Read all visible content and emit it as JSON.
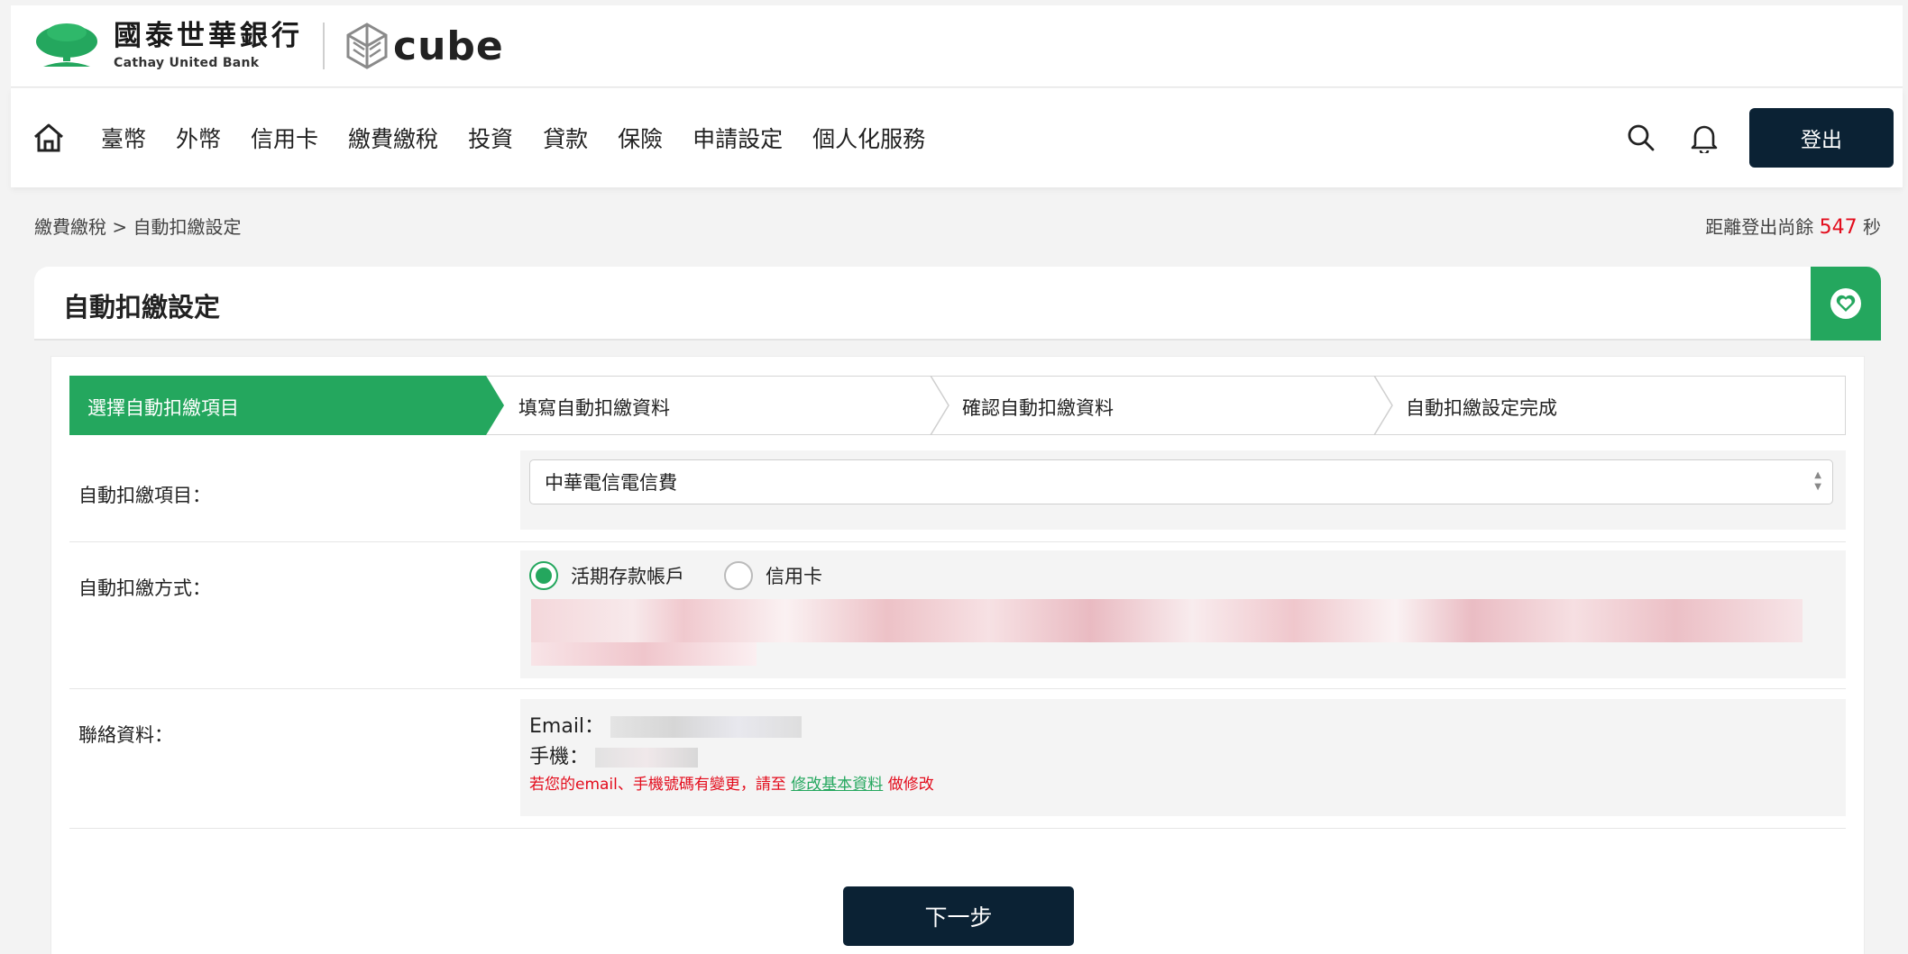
{
  "brand": {
    "bank_name_zh": "國泰世華銀行",
    "bank_name_en": "Cathay United Bank",
    "sub_brand": "cube",
    "primary_color": "#24a75e",
    "dark_color": "#0b2234"
  },
  "nav": {
    "home_icon": "home-icon",
    "items": [
      "臺幣",
      "外幣",
      "信用卡",
      "繳費繳稅",
      "投資",
      "貸款",
      "保險",
      "申請設定",
      "個人化服務"
    ],
    "search_icon": "search-icon",
    "bell_icon": "bell-icon",
    "logout_label": "登出"
  },
  "breadcrumb": "繳費繳稅 > 自動扣繳設定",
  "countdown": {
    "prefix": "距離登出尚餘",
    "seconds": "547",
    "suffix": "秒"
  },
  "page": {
    "title": "自動扣繳設定",
    "favorite_icon": "heart-icon"
  },
  "steps": [
    {
      "label": "選擇自動扣繳項目",
      "active": true
    },
    {
      "label": "填寫自動扣繳資料",
      "active": false
    },
    {
      "label": "確認自動扣繳資料",
      "active": false
    },
    {
      "label": "自動扣繳設定完成",
      "active": false
    }
  ],
  "form": {
    "item_label": "自動扣繳項目：",
    "item_value": "中華電信電信費",
    "method_label": "自動扣繳方式：",
    "method_options": [
      "活期存款帳戶",
      "信用卡"
    ],
    "method_selected": "活期存款帳戶",
    "contact_label": "聯絡資料：",
    "email_label": "Email：",
    "phone_label": "手機：",
    "note_prefix": "若您的email、手機號碼有變更，請至",
    "note_link": "修改基本資料",
    "note_suffix": "做修改"
  },
  "next_label": "下一步"
}
